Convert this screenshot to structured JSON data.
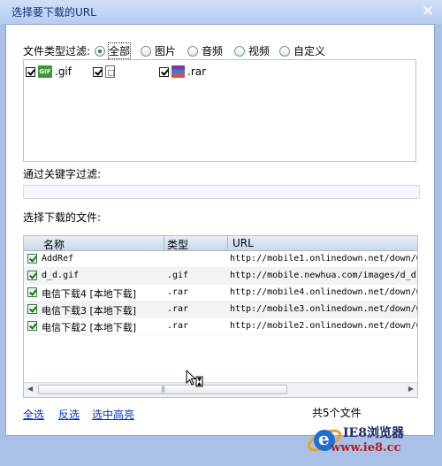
{
  "window": {
    "title": "选择要下载的URL",
    "close_symbol": "✕"
  },
  "filter": {
    "label": "文件类型过滤:",
    "options": [
      {
        "label": "全部",
        "selected": true
      },
      {
        "label": "图片",
        "selected": false
      },
      {
        "label": "音频",
        "selected": false
      },
      {
        "label": "视频",
        "selected": false
      },
      {
        "label": "自定义",
        "selected": false
      }
    ]
  },
  "file_types": [
    {
      "icon": "gif-file-icon",
      "label": ".gif",
      "checked": true
    },
    {
      "icon": "generic-file-icon",
      "label": "",
      "checked": true
    },
    {
      "icon": "rar-archive-icon",
      "label": ".rar",
      "checked": true
    }
  ],
  "keyword": {
    "label": "通过关键字过滤:",
    "value": ""
  },
  "files": {
    "label": "选择下载的文件:",
    "columns": {
      "name": "名称",
      "type": "类型",
      "url": "URL"
    },
    "rows": [
      {
        "name": "AddRef",
        "type": "",
        "url": "http://mobile1.onlinedown.net/down/QQ2",
        "checked": true
      },
      {
        "name": "d_d.gif",
        "type": ".gif",
        "url": "http://mobile.newhua.com/images/d_d.gi",
        "checked": true
      },
      {
        "name": "电信下载4 [本地下载]",
        "type": ".rar",
        "url": "http://mobile4.onlinedown.net/down/QQ2",
        "checked": true
      },
      {
        "name": "电信下载3 [本地下载]",
        "type": ".rar",
        "url": "http://mobile3.onlinedown.net/down/QQ2",
        "checked": true
      },
      {
        "name": "电信下载2 [本地下载]",
        "type": ".rar",
        "url": "http://mobile2.onlinedown.net/down/QQ2",
        "checked": true
      }
    ]
  },
  "scroll": {
    "left_arrow": "◀",
    "right_arrow": "▶",
    "grip": "|||"
  },
  "actions": {
    "select_all": "全选",
    "invert": "反选",
    "highlight": "选中高亮"
  },
  "status": {
    "count": "共5个文件"
  },
  "watermark": {
    "brand": "IE8浏览器",
    "url": "www.ie8.cc",
    "letter": "e"
  },
  "colors": {
    "title_text": "#15307a",
    "link": "#0033cc",
    "frame": "#a9c1e6"
  }
}
